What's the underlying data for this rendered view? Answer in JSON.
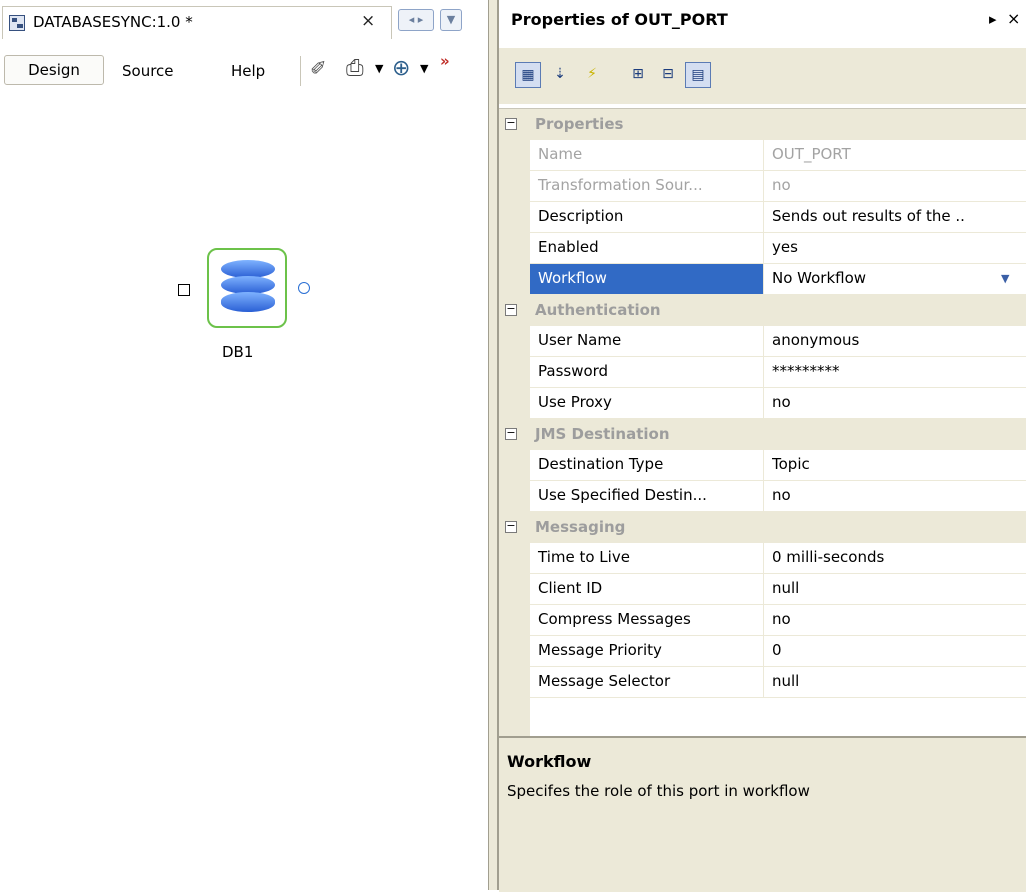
{
  "editor": {
    "tab_title": "DATABASESYNC:1.0 *",
    "tab_close": "×",
    "toolbar": {
      "design": "Design",
      "source": "Source",
      "help": "Help",
      "overflow": "»"
    },
    "node": {
      "label": "DB1"
    }
  },
  "properties": {
    "title": "Properties of OUT_PORT",
    "close": "×",
    "categories": [
      {
        "label": "Properties",
        "toggle": "−",
        "rows": [
          {
            "name": "Name",
            "value": "OUT_PORT"
          },
          {
            "name": "Transformation Sour...",
            "value": "no"
          },
          {
            "name": "Description",
            "value": "Sends out results of the .."
          },
          {
            "name": "Enabled",
            "value": "yes"
          },
          {
            "name": "Workflow",
            "value": "No Workflow"
          }
        ]
      },
      {
        "label": "Authentication",
        "toggle": "−",
        "rows": [
          {
            "name": "User Name",
            "value": "anonymous"
          },
          {
            "name": "Password",
            "value": "*********"
          },
          {
            "name": "Use Proxy",
            "value": "no"
          }
        ]
      },
      {
        "label": "JMS Destination",
        "toggle": "−",
        "rows": [
          {
            "name": "Destination Type",
            "value": "Topic"
          },
          {
            "name": "Use Specified Destin...",
            "value": "no"
          }
        ]
      },
      {
        "label": "Messaging",
        "toggle": "−",
        "rows": [
          {
            "name": "Time to Live",
            "value": "0 milli-seconds"
          },
          {
            "name": "Client ID",
            "value": "null"
          },
          {
            "name": "Compress Messages",
            "value": "no"
          },
          {
            "name": "Message Priority",
            "value": "0"
          },
          {
            "name": "Message Selector",
            "value": "null"
          }
        ]
      }
    ],
    "description": {
      "title": "Workflow",
      "text": "Specifes the role of this port in workflow"
    }
  }
}
